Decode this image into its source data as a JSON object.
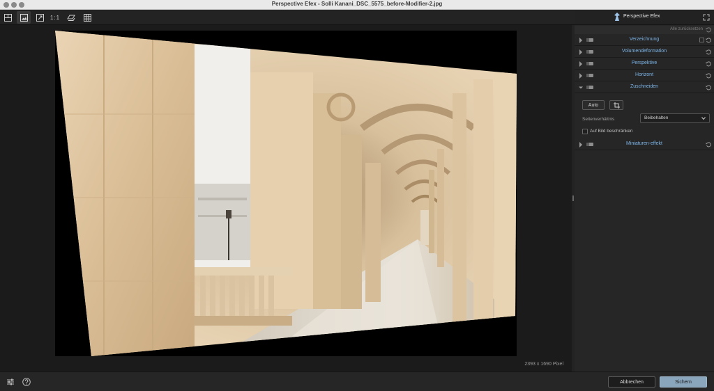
{
  "window": {
    "title": "Perspective Efex - Solli Kanani_DSC_5575_before-Modifier-2.jpg"
  },
  "toolbar": {
    "zoom_label": "1:1",
    "icons": [
      "split-view-icon",
      "single-view-icon",
      "fit-view-icon",
      "zoom-1-1",
      "layers-icon",
      "grid-icon"
    ]
  },
  "canvas": {
    "pixel_size": "2393 x 1690 Pixel"
  },
  "panel": {
    "title": "Perspective Efex",
    "reset_all": "Alle zurücksetzen",
    "sections": [
      {
        "label": "Verzeichnung",
        "expanded": false
      },
      {
        "label": "Volumendeformation",
        "expanded": false
      },
      {
        "label": "Perspektive",
        "expanded": false
      },
      {
        "label": "Horizont",
        "expanded": false
      },
      {
        "label": "Zuschneiden",
        "expanded": true
      },
      {
        "label": "Miniaturen-effekt",
        "expanded": false
      }
    ],
    "crop": {
      "auto_label": "Auto",
      "aspect_label": "Seitenverhältnis",
      "aspect_value": "Beibehalten",
      "constrain_label": "Auf Bild beschränken",
      "constrain_checked": false
    }
  },
  "footer": {
    "cancel_label": "Abbrechen",
    "save_label": "Sichern"
  },
  "colors": {
    "accent_label": "#7db4e6",
    "save_button": "#8aa6bd"
  }
}
